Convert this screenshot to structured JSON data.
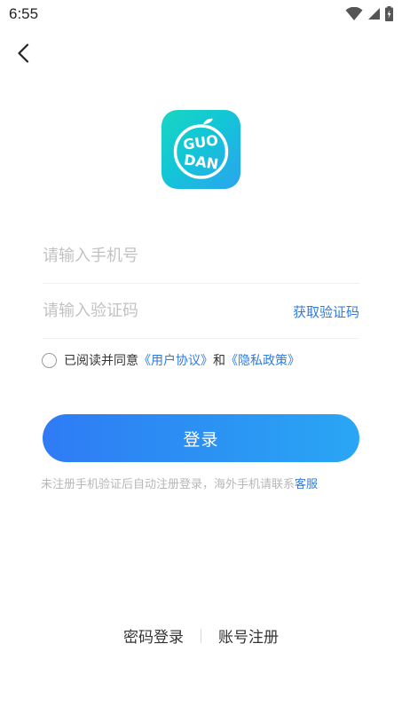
{
  "status_bar": {
    "time": "6:55",
    "icons": [
      "wifi-icon",
      "signal-icon",
      "battery-icon"
    ]
  },
  "nav": {
    "back_icon": "chevron-left-icon"
  },
  "logo": {
    "text": "GUO DAN",
    "colors": [
      "#19d6c2",
      "#2aa4f0"
    ]
  },
  "phone_input": {
    "placeholder": "请输入手机号",
    "value": ""
  },
  "code_input": {
    "placeholder": "请输入验证码",
    "value": ""
  },
  "get_code_label": "获取验证码",
  "agreement": {
    "checked": false,
    "prefix": "已阅读并同意",
    "user_agreement": "《用户协议》",
    "and": "和",
    "privacy_policy": "《隐私政策》"
  },
  "login_button_label": "登录",
  "hint": {
    "text": "未注册手机验证后自动注册登录，海外手机请联系",
    "service": "客服"
  },
  "bottom_links": {
    "password_login": "密码登录",
    "account_register": "账号注册"
  },
  "colors": {
    "accent": "#2d7be5",
    "button_start": "#2f7bf5",
    "button_end": "#2aa6f5",
    "placeholder": "#c2c2c2",
    "hint": "#b7b7b7"
  }
}
